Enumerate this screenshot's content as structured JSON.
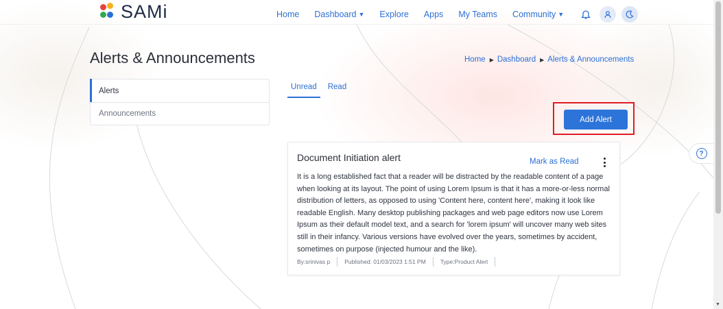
{
  "brand": {
    "name": "SAMi"
  },
  "nav": {
    "home": "Home",
    "dashboard": "Dashboard",
    "explore": "Explore",
    "apps": "Apps",
    "my_teams": "My Teams",
    "community": "Community"
  },
  "page": {
    "title": "Alerts & Announcements"
  },
  "breadcrumb": [
    "Home",
    "Dashboard",
    "Alerts & Announcements"
  ],
  "sidebar": {
    "items": [
      {
        "label": "Alerts",
        "active": true
      },
      {
        "label": "Announcements",
        "active": false
      }
    ]
  },
  "tabs": [
    {
      "label": "Unread",
      "active": true
    },
    {
      "label": "Read",
      "active": false
    }
  ],
  "actions": {
    "add_alert": "Add Alert"
  },
  "alert": {
    "title": "Document Initiation alert",
    "mark_read": "Mark as Read",
    "body": "It is a long established fact that a reader will be distracted by the readable content of a page when looking at its layout. The point of using Lorem Ipsum is that it has a more-or-less normal distribution of letters, as opposed to using 'Content here, content here', making it look like readable English. Many desktop publishing packages and web page editors now use Lorem Ipsum as their default model text, and a search for 'lorem ipsum' will uncover many web sites still in their infancy. Various versions have evolved over the years, sometimes by accident, sometimes on purpose (injected humour and the like).",
    "by": "By:srinivas p",
    "published": "Published: 01/03/2023 1:51 PM",
    "type": "Type:Product Alert"
  },
  "colors": {
    "accent": "#2b6fd6",
    "button": "#2d74da",
    "highlight": "#e01b24"
  }
}
